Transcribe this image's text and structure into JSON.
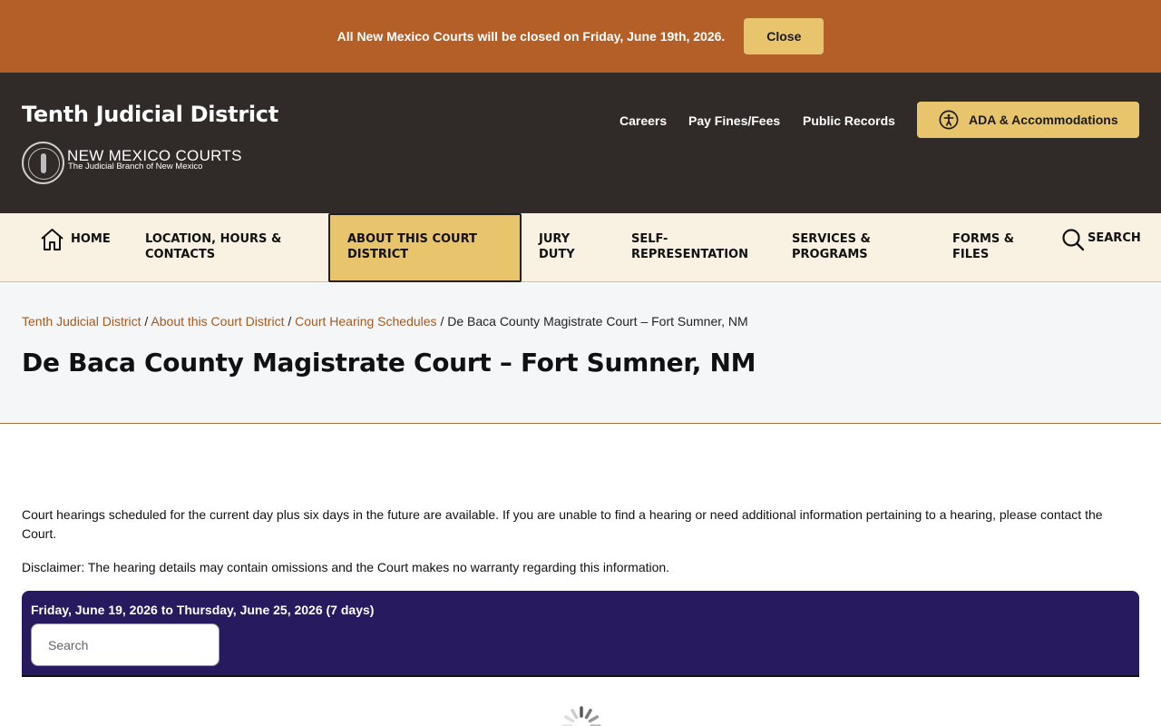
{
  "alert": {
    "message": "All New Mexico Courts will be closed on Friday, June 19th, 2026.",
    "close_label": "Close"
  },
  "header": {
    "site_title": "Tenth Judicial District",
    "courts_name": "NEW MEXICO COURTS",
    "courts_subtitle": "The Judicial Branch of New Mexico",
    "links": [
      "Careers",
      "Pay Fines/Fees",
      "Public Records"
    ],
    "ada_label": "ADA & Accommodations"
  },
  "nav": {
    "home": "HOME",
    "location": [
      "LOCATION, HOURS &",
      "CONTACTS"
    ],
    "about": [
      "ABOUT THIS COURT",
      "DISTRICT"
    ],
    "jury": [
      "JURY",
      "DUTY"
    ],
    "self_rep": [
      "SELF-",
      "REPRESENTATION"
    ],
    "services": [
      "SERVICES &",
      "PROGRAMS"
    ],
    "forms": [
      "FORMS &",
      "FILES"
    ],
    "search": "SEARCH"
  },
  "breadcrumb": {
    "items": [
      "Tenth Judicial District",
      "About this Court District",
      "Court Hearing Schedules"
    ],
    "separator": " / ",
    "current": "De Baca County Magistrate Court – Fort Sumner, NM"
  },
  "page": {
    "title": "De Baca County Magistrate Court – Fort Sumner, NM",
    "intro": "Court hearings scheduled for the current day plus six days in the future are available. If you are unable to find a hearing or need additional information pertaining to a hearing, please contact the Court.",
    "disclaimer": "Disclaimer:  The hearing details may contain omissions and the Court makes no warranty regarding this information."
  },
  "schedule": {
    "range": "Friday, June 19, 2026 to Thursday, June 25, 2026 (7 days)",
    "search_placeholder": "Search"
  },
  "colors": {
    "alert_bg": "#b35f27",
    "header_bg": "#302b28",
    "accent_gold": "#e8c46c",
    "nav_bg": "#f9f1e1",
    "panel_bg": "#281a5e",
    "link": "#a35a22"
  }
}
